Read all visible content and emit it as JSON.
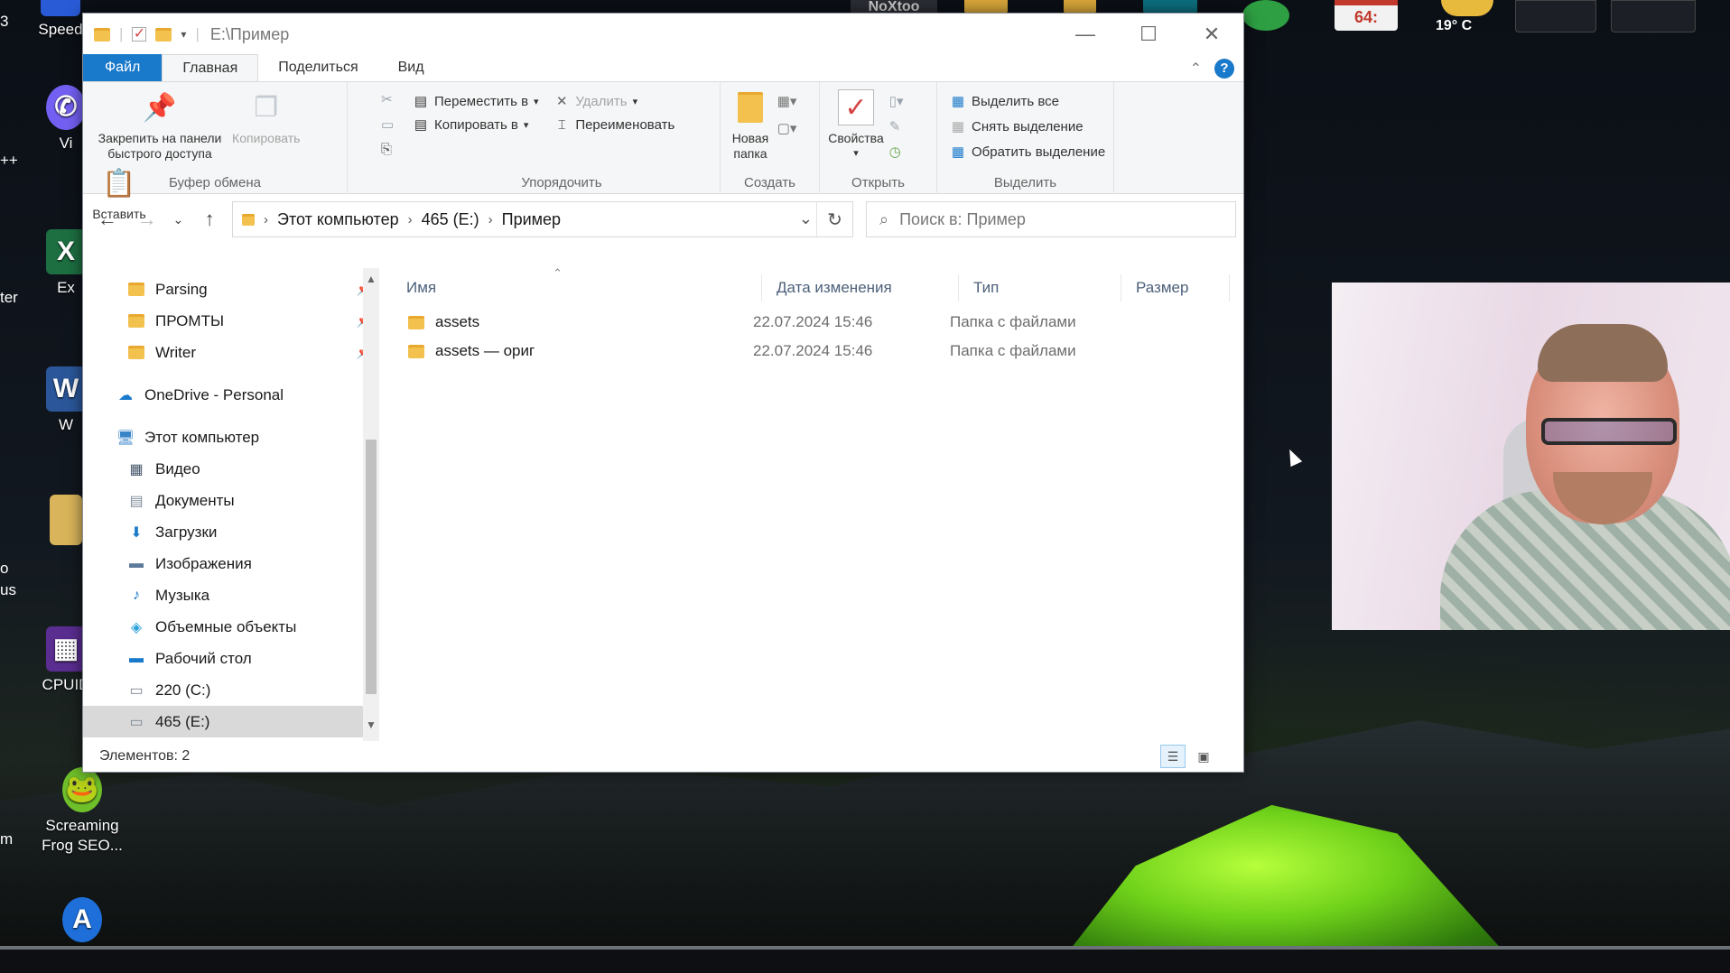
{
  "desktop": {
    "icons": [
      {
        "label": "Speed",
        "icon": "speed-app-icon",
        "color": "#2a5bd7"
      },
      {
        "label": "Vi",
        "icon": "viber-icon",
        "color": "#7360f2"
      },
      {
        "label": "Ex",
        "icon": "excel-icon",
        "color": "#1d6f42"
      },
      {
        "label": "W",
        "icon": "word-icon",
        "color": "#2b579a"
      },
      {
        "label": "CPUID",
        "icon": "cpuid-icon",
        "color": "#5a2d91"
      },
      {
        "label": "Screaming Frog SEO...",
        "icon": "screaming-frog-icon",
        "color": "#6fbf2a"
      }
    ],
    "edge_texts": [
      "3",
      "++",
      "ter",
      "o",
      "us",
      "m"
    ],
    "topbar": {
      "label_noxtoo": "NoXtoo",
      "calendar": "64:",
      "weather_temp": "19° C"
    }
  },
  "window": {
    "title_path": "E:\\Пример",
    "accent": "#1979ca",
    "tabs": [
      "Файл",
      "Главная",
      "Поделиться",
      "Вид"
    ],
    "ribbon": {
      "clipboard": {
        "pin_label_1": "Закрепить на панели",
        "pin_label_2": "быстрого доступа",
        "copy": "Копировать",
        "paste": "Вставить",
        "group": "Буфер обмена"
      },
      "organize": {
        "move_to": "Переместить в",
        "copy_to": "Копировать в",
        "delete": "Удалить",
        "rename": "Переименовать",
        "group": "Упорядочить"
      },
      "create": {
        "new_folder_1": "Новая",
        "new_folder_2": "папка",
        "group": "Создать"
      },
      "open": {
        "properties": "Свойства",
        "group": "Открыть"
      },
      "select": {
        "select_all": "Выделить все",
        "select_none": "Снять выделение",
        "invert": "Обратить выделение",
        "group": "Выделить"
      }
    },
    "address": {
      "crumbs": [
        "Этот компьютер",
        "465 (E:)",
        "Пример"
      ],
      "search_placeholder": "Поиск в: Пример"
    },
    "nav": {
      "pinned": [
        {
          "label": "Parsing",
          "icon": "folder-icon"
        },
        {
          "label": "ПРОМТЫ",
          "icon": "folder-icon"
        },
        {
          "label": "Writer",
          "icon": "folder-icon"
        }
      ],
      "onedrive": "OneDrive - Personal",
      "this_pc": "Этот компьютер",
      "pc_items": [
        {
          "label": "Видео",
          "icon": "video-icon"
        },
        {
          "label": "Документы",
          "icon": "documents-icon"
        },
        {
          "label": "Загрузки",
          "icon": "downloads-icon"
        },
        {
          "label": "Изображения",
          "icon": "pictures-icon"
        },
        {
          "label": "Музыка",
          "icon": "music-icon"
        },
        {
          "label": "Объемные объекты",
          "icon": "3d-objects-icon"
        },
        {
          "label": "Рабочий стол",
          "icon": "desktop-icon"
        },
        {
          "label": "220 (C:)",
          "icon": "drive-icon"
        },
        {
          "label": "465 (E:)",
          "icon": "drive-icon",
          "selected": true
        }
      ]
    },
    "columns": {
      "name": "Имя",
      "date": "Дата изменения",
      "type": "Тип",
      "size": "Размер"
    },
    "files": [
      {
        "name": "assets",
        "date": "22.07.2024 15:46",
        "type": "Папка с файлами"
      },
      {
        "name": "assets — ориг",
        "date": "22.07.2024 15:46",
        "type": "Папка с файлами"
      }
    ],
    "status": "Элементов: 2"
  }
}
